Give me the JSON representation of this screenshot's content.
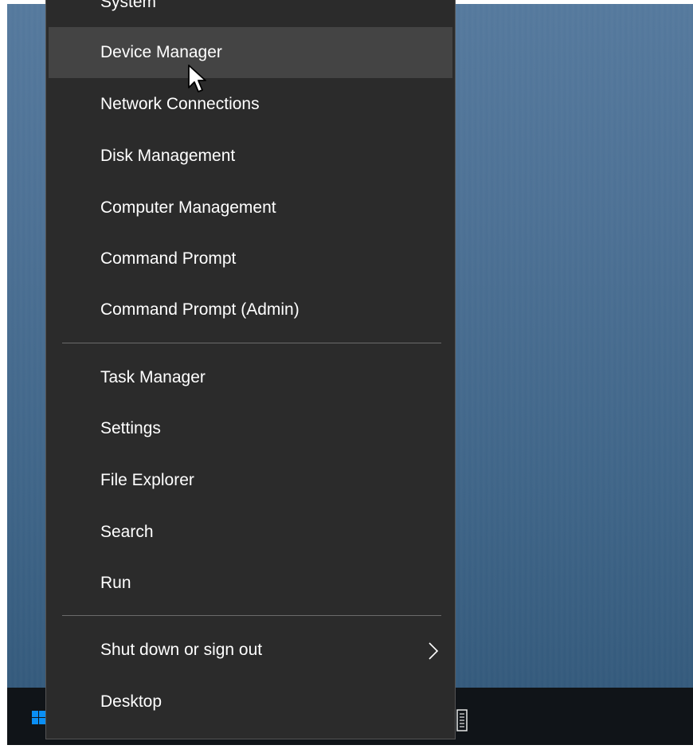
{
  "menu": {
    "items": [
      {
        "label": "System"
      },
      {
        "label": "Device Manager"
      },
      {
        "label": "Network Connections"
      },
      {
        "label": "Disk Management"
      },
      {
        "label": "Computer Management"
      },
      {
        "label": "Command Prompt"
      },
      {
        "label": "Command Prompt (Admin)"
      },
      {
        "label": "Task Manager"
      },
      {
        "label": "Settings"
      },
      {
        "label": "File Explorer"
      },
      {
        "label": "Search"
      },
      {
        "label": "Run"
      },
      {
        "label": "Shut down or sign out"
      },
      {
        "label": "Desktop"
      }
    ],
    "highlighted_item": "Device Manager",
    "submenu_icon": "chevron-right-icon"
  },
  "taskbar": {
    "start_icon": "windows-logo-icon"
  },
  "colors": {
    "menu_background": "#2b2b2b",
    "menu_highlight": "#444444",
    "menu_text": "#ffffff",
    "separator": "#6b6b6b",
    "taskbar": "#101418",
    "desktop_accent": "#4d7195",
    "windows_logo": "#0a8ff5"
  }
}
